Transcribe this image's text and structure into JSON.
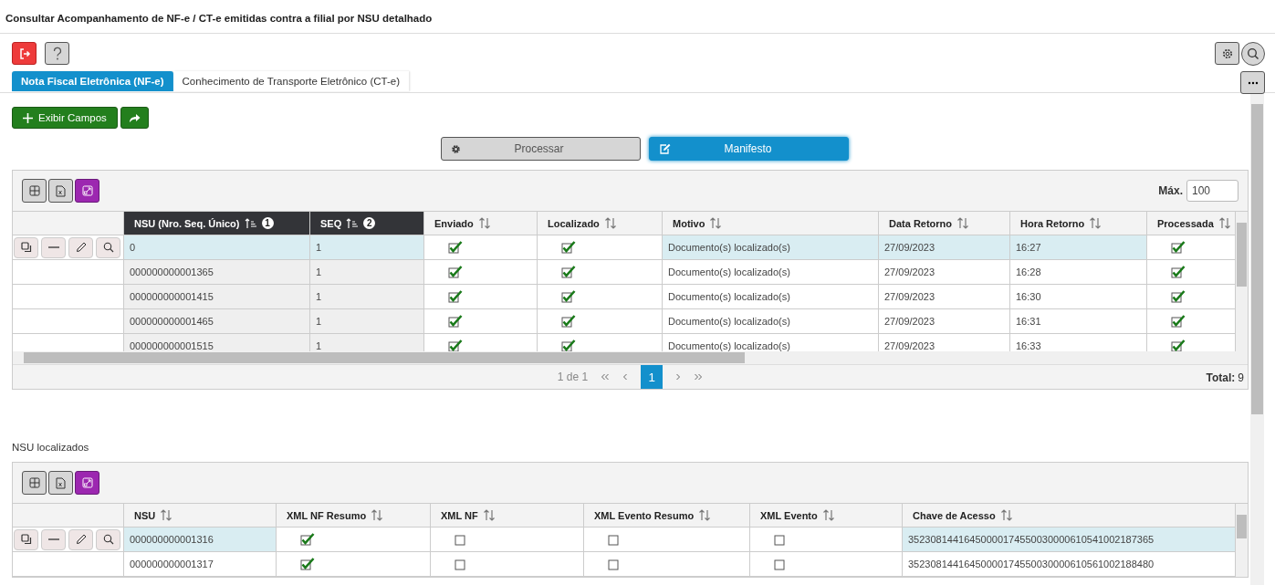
{
  "page_title": "Consultar Acompanhamento de NF-e / CT-e emitidas contra a filial por NSU detalhado",
  "tabs": [
    {
      "label": "Nota Fiscal Eletrônica (NF-e)",
      "selected": true
    },
    {
      "label": "Conhecimento de Transporte Eletrônico (CT-e)",
      "selected": false
    }
  ],
  "show_fields_label": "Exibir Campos",
  "process_buttons": [
    {
      "label": "Processar",
      "kind": "process"
    },
    {
      "label": "Manifesto",
      "kind": "manifest"
    }
  ],
  "main_grid": {
    "max_label": "Máx.",
    "max_value": "100",
    "columns": [
      {
        "label": "NSU (Nro. Seq. Único)",
        "kind": "text",
        "sorted": true,
        "sort_rank": "1"
      },
      {
        "label": "SEQ",
        "kind": "text",
        "sorted": true,
        "sort_rank": "2"
      },
      {
        "label": "Enviado",
        "kind": "check",
        "sorted": false
      },
      {
        "label": "Localizado",
        "kind": "check",
        "sorted": false
      },
      {
        "label": "Motivo",
        "kind": "text",
        "sorted": false
      },
      {
        "label": "Data Retorno",
        "kind": "text",
        "sorted": false
      },
      {
        "label": "Hora Retorno",
        "kind": "text",
        "sorted": false
      },
      {
        "label": "Processada",
        "kind": "check",
        "sorted": false
      }
    ],
    "rows": [
      {
        "selected": true,
        "cells": [
          "0",
          "1",
          true,
          true,
          "Documento(s) localizado(s)",
          "27/09/2023",
          "16:27",
          true
        ]
      },
      {
        "selected": false,
        "cells": [
          "000000000001365",
          "1",
          true,
          true,
          "Documento(s) localizado(s)",
          "27/09/2023",
          "16:28",
          true
        ]
      },
      {
        "selected": false,
        "cells": [
          "000000000001415",
          "1",
          true,
          true,
          "Documento(s) localizado(s)",
          "27/09/2023",
          "16:30",
          true
        ]
      },
      {
        "selected": false,
        "cells": [
          "000000000001465",
          "1",
          true,
          true,
          "Documento(s) localizado(s)",
          "27/09/2023",
          "16:31",
          true
        ]
      },
      {
        "selected": false,
        "cells": [
          "000000000001515",
          "1",
          true,
          true,
          "Documento(s) localizado(s)",
          "27/09/2023",
          "16:33",
          true
        ]
      }
    ],
    "pager": {
      "info": "1 de 1",
      "pages": [
        {
          "label": "1",
          "selected": true
        }
      ],
      "total_label": "Total:",
      "total": "9"
    }
  },
  "nsu_section": {
    "title": "NSU localizados",
    "columns": [
      {
        "label": "NSU",
        "kind": "text",
        "sorted": false
      },
      {
        "label": "XML NF Resumo",
        "kind": "check",
        "sorted": false
      },
      {
        "label": "XML NF",
        "kind": "check",
        "sorted": false
      },
      {
        "label": "XML Evento Resumo",
        "kind": "check",
        "sorted": false
      },
      {
        "label": "XML Evento",
        "kind": "check",
        "sorted": false
      },
      {
        "label": "Chave de Acesso",
        "kind": "text",
        "sorted": false
      }
    ],
    "rows": [
      {
        "selected": true,
        "cells": [
          "000000000001316",
          true,
          false,
          false,
          false,
          "35230814416450000174550030000610541002187365"
        ]
      },
      {
        "selected": false,
        "cells": [
          "000000000001317",
          true,
          false,
          false,
          false,
          "35230814416450000174550030000610561002188480"
        ]
      }
    ]
  }
}
